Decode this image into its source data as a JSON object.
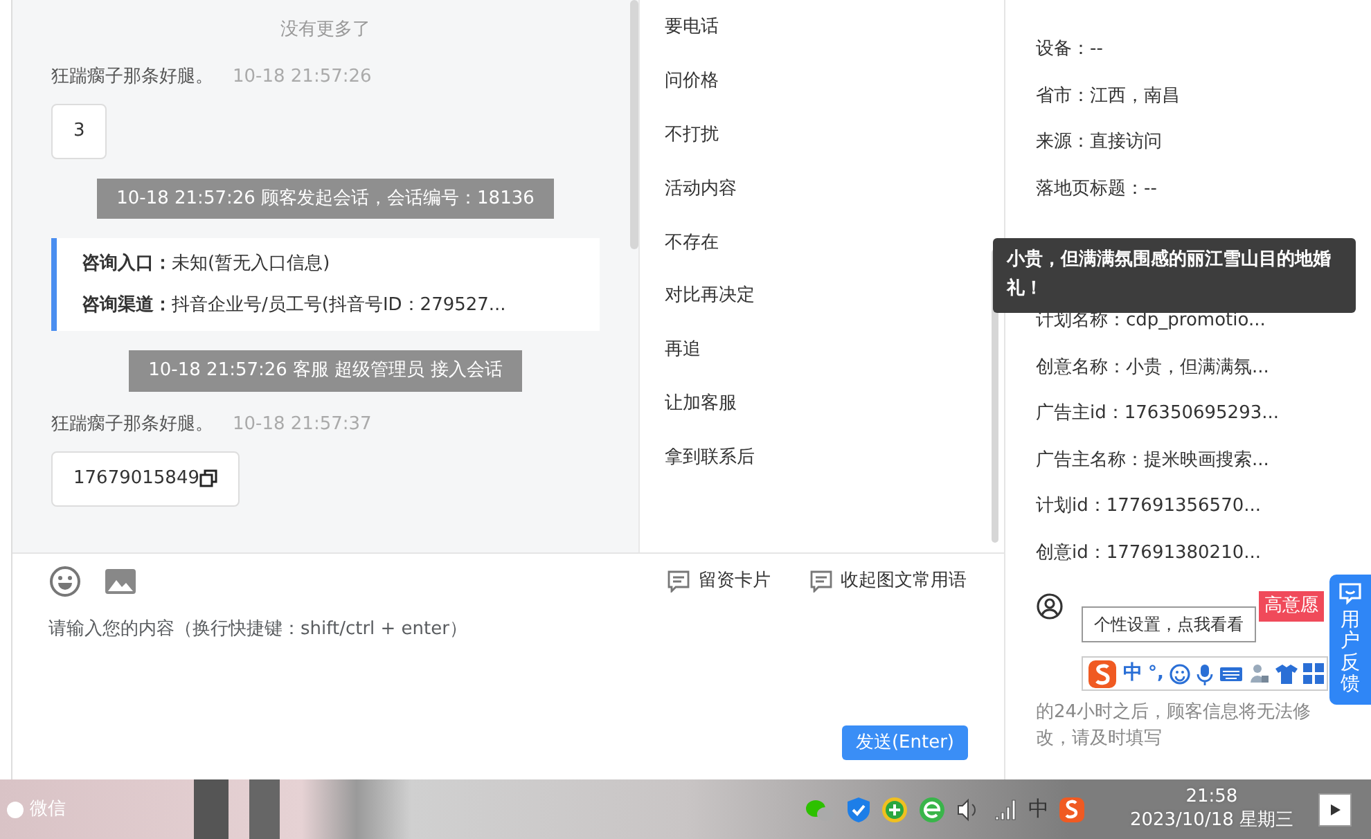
{
  "chat": {
    "status": "没有更多了",
    "messages": [
      {
        "kind": "message",
        "sender": "狂踹瘸子那条好腿。",
        "time": "10-18 21:57:26",
        "text": "3",
        "copyable": false
      },
      {
        "kind": "system",
        "text": "10-18 21:57:26 顾客发起会话，会话编号：18136"
      },
      {
        "kind": "info",
        "lines": [
          {
            "label": "咨询入口：",
            "value": "未知(暂无入口信息)"
          },
          {
            "label": "咨询渠道：",
            "value": "抖音企业号/员工号(抖音号ID：279527..."
          }
        ]
      },
      {
        "kind": "system",
        "text": "10-18 21:57:26 客服 超级管理员 接入会话"
      },
      {
        "kind": "message",
        "sender": "狂踹瘸子那条好腿。",
        "time": "10-18 21:57:37",
        "text": "17679015849",
        "copyable": true
      }
    ]
  },
  "quick_phrases": [
    "要电话",
    "问价格",
    "不打扰",
    "活动内容",
    "不存在",
    "对比再决定",
    "再追",
    "让加客服",
    "拿到联系后"
  ],
  "composer": {
    "actions": [
      "留资卡片",
      "收起图文常用语"
    ],
    "placeholder": "请输入您的内容（换行快捷键：shift/ctrl + enter）",
    "send_button": "发送(Enter)"
  },
  "source_info": {
    "fields": [
      "设备：--",
      "省市：江西，南昌",
      "来源：直接访问",
      "落地页标题：--",
      "计划名称：cdp_promotio...",
      "创意名称：小贵，但满满氛...",
      "广告主id：176350695293...",
      "广告主名称：提米映画搜索...",
      "计划id：177691356570...",
      "创意id：177691380210..."
    ],
    "tooltip": "小贵，但满满氛围感的丽江雪山目的地婚礼！"
  },
  "customer": {
    "badge": "高意愿",
    "note": "的24小时之后，顾客信息将无法修改，请及时填写"
  },
  "feedback_tab": "用户反馈",
  "ime": {
    "hint": "个性设置，点我看看",
    "mode": "中",
    "punct": "°,"
  },
  "taskbar": {
    "app": "微信",
    "language": "中",
    "time": "21:58",
    "date": "2023/10/18 星期三"
  }
}
